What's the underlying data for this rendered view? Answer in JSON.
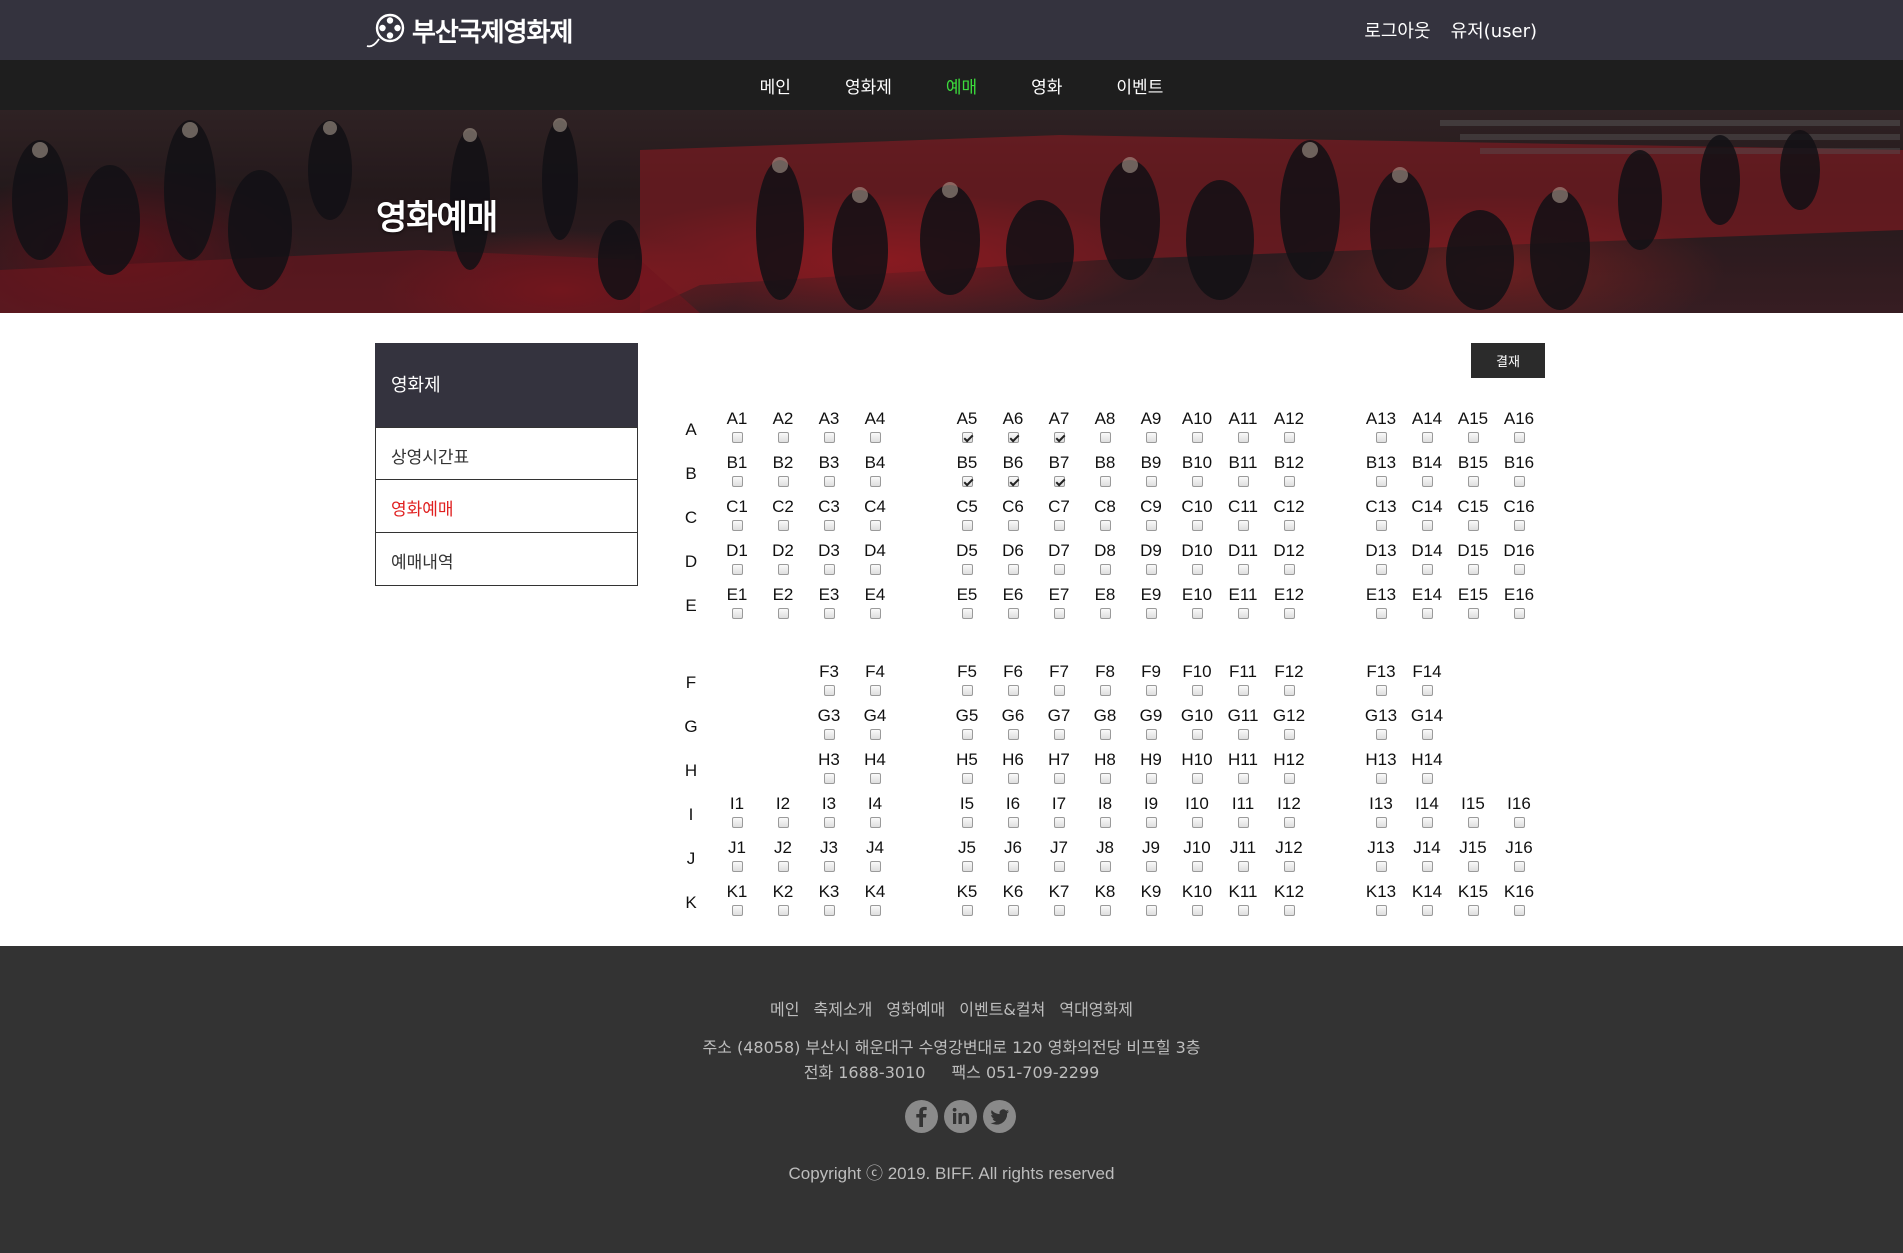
{
  "brand": {
    "name": "부산국제영화제"
  },
  "user_links": {
    "logout": "로그아웃",
    "user": "유저(user)"
  },
  "nav": {
    "items": [
      "메인",
      "영화제",
      "예매",
      "영화",
      "이벤트"
    ],
    "active_index": 2,
    "active_color": "#3cdc3c"
  },
  "hero": {
    "title": "영화예매"
  },
  "sidebar": {
    "header": "영화제",
    "items": [
      "상영시간표",
      "영화예매",
      "예매내역"
    ],
    "active_index": 1,
    "active_color": "#e02020"
  },
  "booking": {
    "pay_label": "결재",
    "rows": [
      {
        "row": "A",
        "seats": [
          1,
          2,
          3,
          4,
          5,
          6,
          7,
          8,
          9,
          10,
          11,
          12,
          13,
          14,
          15,
          16
        ],
        "checked": [
          5,
          6,
          7
        ]
      },
      {
        "row": "B",
        "seats": [
          1,
          2,
          3,
          4,
          5,
          6,
          7,
          8,
          9,
          10,
          11,
          12,
          13,
          14,
          15,
          16
        ],
        "checked": [
          5,
          6,
          7
        ]
      },
      {
        "row": "C",
        "seats": [
          1,
          2,
          3,
          4,
          5,
          6,
          7,
          8,
          9,
          10,
          11,
          12,
          13,
          14,
          15,
          16
        ],
        "checked": []
      },
      {
        "row": "D",
        "seats": [
          1,
          2,
          3,
          4,
          5,
          6,
          7,
          8,
          9,
          10,
          11,
          12,
          13,
          14,
          15,
          16
        ],
        "checked": []
      },
      {
        "row": "E",
        "seats": [
          1,
          2,
          3,
          4,
          5,
          6,
          7,
          8,
          9,
          10,
          11,
          12,
          13,
          14,
          15,
          16
        ],
        "checked": []
      },
      {
        "row": "F",
        "seats": [
          3,
          4,
          5,
          6,
          7,
          8,
          9,
          10,
          11,
          12,
          13,
          14
        ],
        "checked": []
      },
      {
        "row": "G",
        "seats": [
          3,
          4,
          5,
          6,
          7,
          8,
          9,
          10,
          11,
          12,
          13,
          14
        ],
        "checked": []
      },
      {
        "row": "H",
        "seats": [
          3,
          4,
          5,
          6,
          7,
          8,
          9,
          10,
          11,
          12,
          13,
          14
        ],
        "checked": []
      },
      {
        "row": "I",
        "seats": [
          1,
          2,
          3,
          4,
          5,
          6,
          7,
          8,
          9,
          10,
          11,
          12,
          13,
          14,
          15,
          16
        ],
        "checked": []
      },
      {
        "row": "J",
        "seats": [
          1,
          2,
          3,
          4,
          5,
          6,
          7,
          8,
          9,
          10,
          11,
          12,
          13,
          14,
          15,
          16
        ],
        "checked": []
      },
      {
        "row": "K",
        "seats": [
          1,
          2,
          3,
          4,
          5,
          6,
          7,
          8,
          9,
          10,
          11,
          12,
          13,
          14,
          15,
          16
        ],
        "checked": []
      }
    ]
  },
  "footer": {
    "links": [
      "메인",
      "축제소개",
      "영화예매",
      "이벤트&컬쳐",
      "역대영화제"
    ],
    "address": "주소 (48058) 부산시 해운대구 수영강변대로 120 영화의전당 비프힐 3층",
    "phone": "전화 1688-3010",
    "fax": "팩스 051-709-2299",
    "social_icons": [
      "facebook-icon",
      "linkedin-icon",
      "twitter-icon"
    ],
    "copyright": "Copyright ⓒ 2019. BIFF. All rights reserved"
  }
}
